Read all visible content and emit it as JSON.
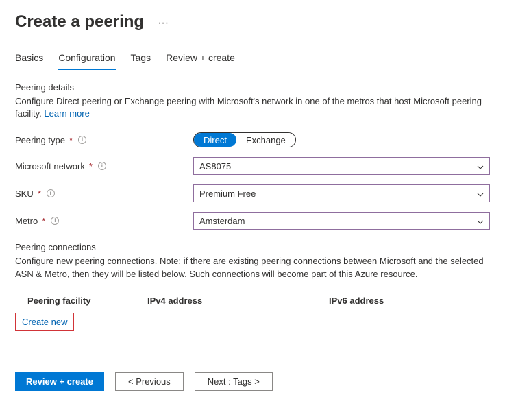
{
  "header": {
    "title": "Create a peering"
  },
  "tabs": [
    {
      "label": "Basics"
    },
    {
      "label": "Configuration"
    },
    {
      "label": "Tags"
    },
    {
      "label": "Review + create"
    }
  ],
  "activeTabIndex": 1,
  "peeringDetails": {
    "heading": "Peering details",
    "description": "Configure Direct peering or Exchange peering with Microsoft's network in one of the metros that host Microsoft peering facility. ",
    "learnMore": "Learn more"
  },
  "form": {
    "peeringType": {
      "label": "Peering type",
      "options": [
        "Direct",
        "Exchange"
      ],
      "selected": "Direct"
    },
    "microsoftNetwork": {
      "label": "Microsoft network",
      "value": "AS8075"
    },
    "sku": {
      "label": "SKU",
      "value": "Premium Free"
    },
    "metro": {
      "label": "Metro",
      "value": "Amsterdam"
    }
  },
  "peeringConnections": {
    "heading": "Peering connections",
    "description": "Configure new peering connections. Note: if there are existing peering connections between Microsoft and the selected ASN & Metro, then they will be listed below. Such connections will become part of this Azure resource.",
    "columns": {
      "facility": "Peering facility",
      "ipv4": "IPv4 address",
      "ipv6": "IPv6 address"
    },
    "createNew": "Create new"
  },
  "footer": {
    "review": "Review + create",
    "previous": "< Previous",
    "next": "Next : Tags >"
  }
}
